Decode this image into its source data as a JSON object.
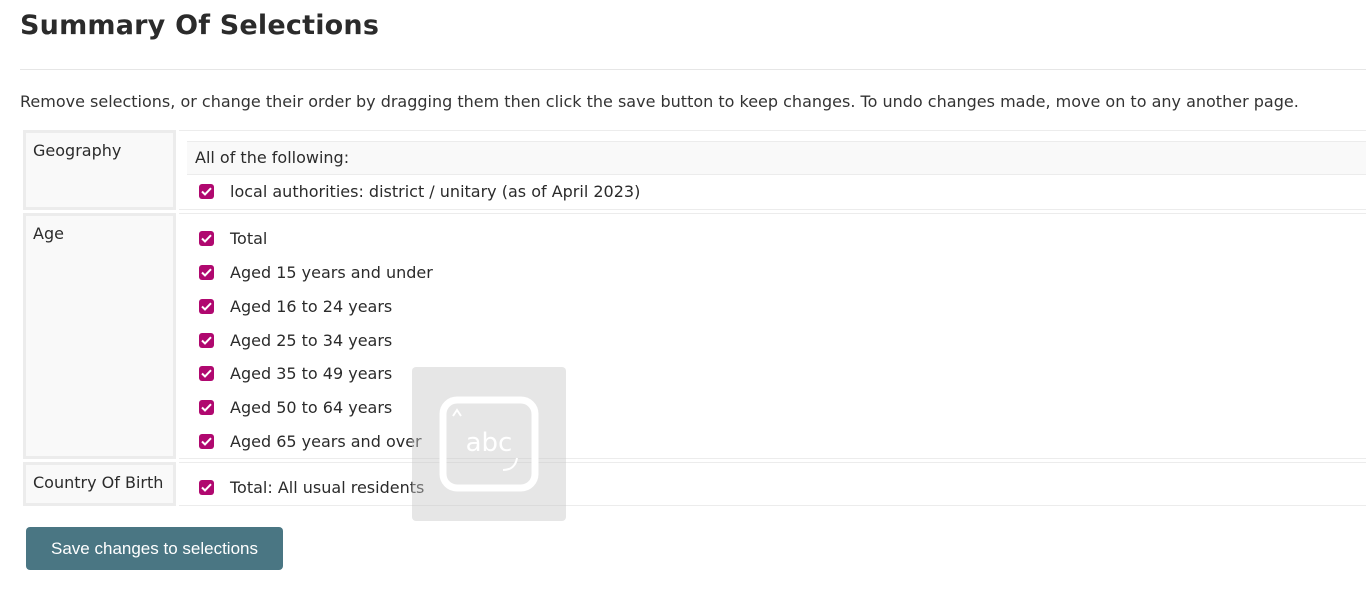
{
  "page": {
    "title": "Summary Of Selections",
    "intro": "Remove selections, or change their order by dragging them then click the save button to keep changes. To undo changes made, move on to any another page."
  },
  "colors": {
    "checkbox": "#b0086f",
    "save_button": "#4a7683"
  },
  "geography": {
    "label": "Geography",
    "header": "All of the following:",
    "items": [
      {
        "label": "local authorities: district / unitary (as of April 2023)",
        "checked": true
      }
    ]
  },
  "age": {
    "label": "Age",
    "items": [
      {
        "label": "Total",
        "checked": true
      },
      {
        "label": "Aged 15 years and under",
        "checked": true
      },
      {
        "label": "Aged 16 to 24 years",
        "checked": true
      },
      {
        "label": "Aged 25 to 34 years",
        "checked": true
      },
      {
        "label": "Aged 35 to 49 years",
        "checked": true
      },
      {
        "label": "Aged 50 to 64 years",
        "checked": true
      },
      {
        "label": "Aged 65 years and over",
        "checked": true
      }
    ]
  },
  "country_of_birth": {
    "label": "Country Of Birth",
    "items": [
      {
        "label": "Total: All usual residents",
        "checked": true
      }
    ]
  },
  "actions": {
    "save_label": "Save changes to selections"
  },
  "watermark": {
    "text": "abc",
    "icon": "keyboard-abc-icon"
  }
}
